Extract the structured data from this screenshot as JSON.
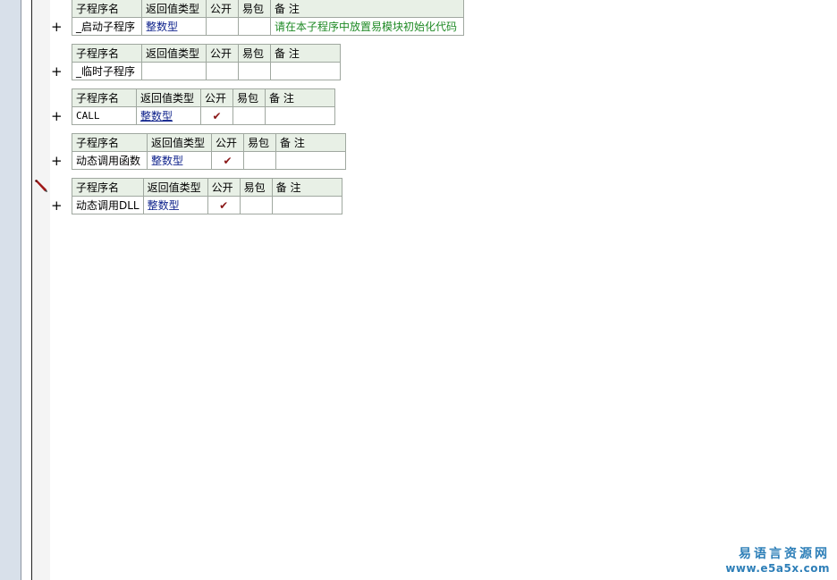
{
  "headers": {
    "name": "子程序名",
    "return_type": "返回值类型",
    "public": "公开",
    "epkg": "易包",
    "note": "备 注"
  },
  "subroutines": [
    {
      "name": "_启动子程序",
      "return_type": "整数型",
      "public": false,
      "note": "请在本子程序中放置易模块初始化代码"
    },
    {
      "name": "_临时子程序",
      "return_type": "",
      "public": false,
      "note": ""
    },
    {
      "name": "CALL",
      "return_type": "整数型",
      "public": true,
      "note": ""
    },
    {
      "name": "动态调用函数",
      "return_type": "整数型",
      "public": true,
      "note": ""
    },
    {
      "name": "动态调用DLL",
      "return_type": "整数型",
      "public": true,
      "note": ""
    }
  ],
  "expand_symbol": "+",
  "check_symbol": "✔",
  "watermark": {
    "title": "易语言资源网",
    "url": "www.e5a5x.com"
  },
  "colors": {
    "header_bg": "#e8f0e6",
    "type_text": "#0b1f8a",
    "note_text": "#1f8a25",
    "check": "#8a1818",
    "watermark": "#2e7fb8"
  }
}
